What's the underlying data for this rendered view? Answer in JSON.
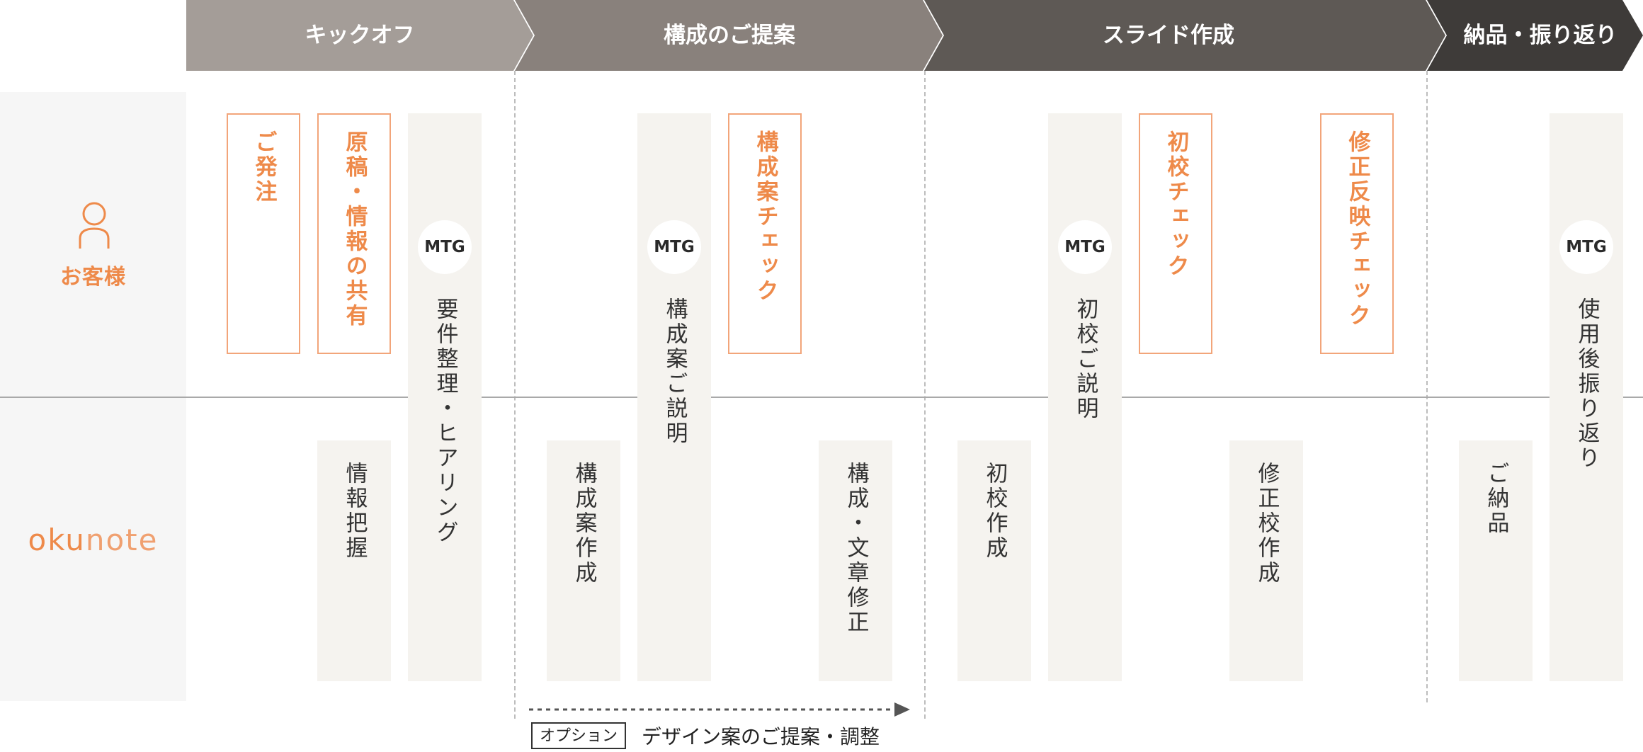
{
  "phases": [
    {
      "label": "キックオフ",
      "color": "#a49d98"
    },
    {
      "label": "構成のご提案",
      "color": "#89817c"
    },
    {
      "label": "スライド作成",
      "color": "#5e5955"
    },
    {
      "label": "納品・振り返り",
      "color": "#3e3b39"
    }
  ],
  "lanes": {
    "customer": {
      "label": "お客様",
      "icon": "person-icon",
      "color": "#ee8a4a"
    },
    "provider": {
      "logo_part1": "oku",
      "logo_part2": "note",
      "color": "#ee8a4a"
    }
  },
  "mtg_label": "MTG",
  "tasks": {
    "order": "ご発注",
    "share_draft": "原稿・情報の共有",
    "kickoff_mtg": "要件整理・ヒアリング",
    "info_grasp": "情報把握",
    "structure_create": "構成案作成",
    "structure_explain": "構成案ご説明",
    "structure_check": "構成案チェック",
    "structure_revise": "構成・文章修正",
    "first_draft_create": "初校作成",
    "first_draft_explain": "初校ご説明",
    "first_draft_check": "初校チェック",
    "revision_create": "修正校作成",
    "revision_check": "修正反映チェック",
    "delivery": "ご納品",
    "post_review": "使用後振り返り"
  },
  "option": {
    "tag": "オプション",
    "text": "デザイン案のご提案・調整"
  }
}
